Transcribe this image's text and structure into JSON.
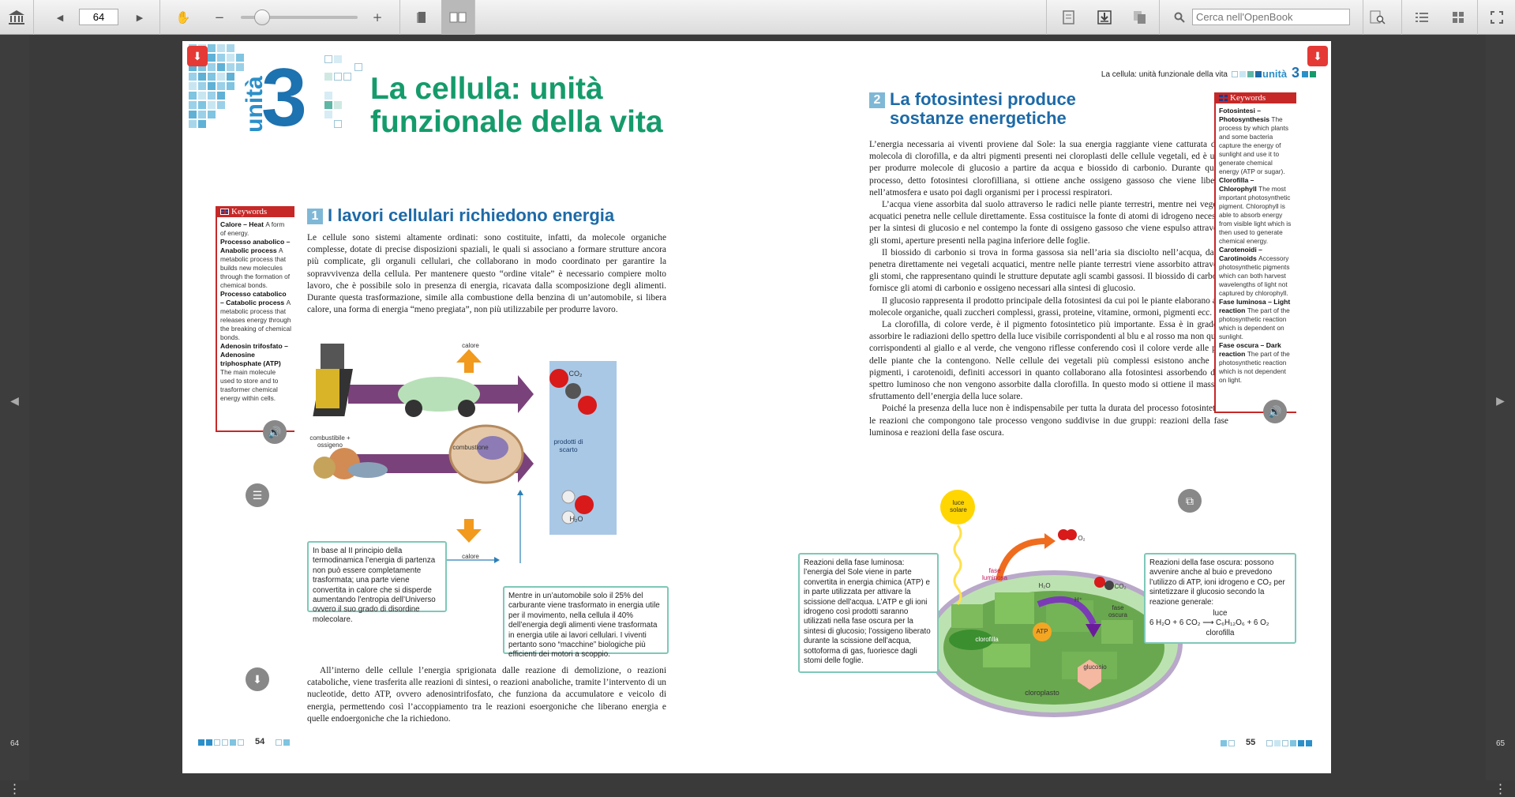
{
  "toolbar": {
    "page_number": "64",
    "search_placeholder": "Cerca nell'OpenBook"
  },
  "rails": {
    "left_page": "64",
    "right_page": "65",
    "left_arrow": "◀",
    "right_arrow": "▶",
    "menu": "⋮"
  },
  "left": {
    "unit_word": "unità",
    "unit_num": "3",
    "title_line1": "La cellula: unità",
    "title_line2": "funzionale della vita",
    "section_num": "1",
    "section_title": "I lavori cellulari richiedono energia",
    "para1": "Le cellule sono sistemi altamente ordinati: sono costituite, infatti, da molecole organiche complesse, dotate di precise disposizioni spaziali, le quali si associano a formare strutture ancora più complicate, gli organuli cellulari, che collaborano in modo coordinato per garantire la sopravvivenza della cellula. Per mantenere questo “ordine vitale” è necessario compiere molto lavoro, che è possibile solo in presenza di energia, ricavata dalla scomposizione degli alimenti. Durante questa trasformazione, simile alla combustione della benzina di un’automobile, si libera calore, una forma di energia “meno pregiata”, non più utilizzabile per produrre lavoro.",
    "para2": "All’interno delle cellule l’energia sprigionata dalle reazione di demolizione, o reazioni cataboliche, viene trasferita alle reazioni di sintesi, o reazioni anaboliche, tramite l’intervento di un nucleotide, detto ATP, ovvero adenosintrifosfato, che funziona da accumulatore e veicolo di energia, permettendo così l’accoppiamento tra le reazioni esoergoniche che liberano energia e quelle endoergoniche che la richiedono.",
    "kw_head": "Keywords",
    "kw_items": [
      {
        "term": "Calore – Heat",
        "def": "A form of energy."
      },
      {
        "term": "Processo anabolico – Anabolic process",
        "def": "A metabolic process that builds new molecules through the formation of chemical bonds."
      },
      {
        "term": "Processo catabolico – Catabolic process",
        "def": "A metabolic process that releases energy through the breaking of chemical bonds."
      },
      {
        "term": "Adenosin trifosfato – Adenosine triphosphate (ATP)",
        "def": "The main molecule used to store and to trasformer chemical energy within cells."
      }
    ],
    "fig": {
      "calore_top": "calore",
      "calore_bottom": "calore",
      "co2": "CO₂",
      "prodotti": "prodotti di scarto",
      "h2o": "H₂O",
      "combustibile": "combustibile + ossigeno",
      "combustione": "combustione",
      "h": "H",
      "o": "O",
      "c": "C"
    },
    "box1": "In base al II principio della termodinamica l’energia di partenza non può essere completamente trasformata; una parte viene convertita in calore che si disperde aumentando l’entropia dell’Universo ovvero il suo grado di disordine molecolare.",
    "box2": "Mentre in un’automobile solo il 25% del carburante viene trasformato in energia utile per il movimento, nella cellula il 40% dell’energia degli alimenti viene trasformata in energia utile ai lavori cellulari. I viventi pertanto sono “macchine” biologiche più efficienti dei motori a scoppio.",
    "page_num": "54"
  },
  "right": {
    "running_head": "La cellula: unità funzionale della vita",
    "unit_word": "unità",
    "unit_num": "3",
    "section_num": "2",
    "section_title1": "La fotosintesi produce",
    "section_title2": "sostanze energetiche",
    "paras": [
      "L’energia necessaria ai viventi proviene dal Sole: la sua energia raggiante viene catturata dalla molecola di clorofilla, e da altri pigmenti presenti nei cloroplasti delle cellule vegetali, ed è usata per produrre molecole di glucosio a partire da acqua e biossido di carbonio. Durante questo processo, detto fotosintesi clorofilliana, si ottiene anche ossigeno gassoso che viene liberato nell’atmosfera e usato poi dagli organismi per i processi respiratori.",
      "L’acqua viene assorbita dal suolo attraverso le radici nelle piante terrestri, mentre nei vegetali acquatici penetra nelle cellule direttamente. Essa costituisce la fonte di atomi di idrogeno necessari per la sintesi di glucosio e nel contempo la fonte di ossigeno gassoso che viene espulso attraverso gli stomi, aperture presenti nella pagina inferiore delle foglie.",
      "Il biossido di carbonio si trova in forma gassosa sia nell’aria sia disciolto nell’acqua, da cui penetra direttamente nei vegetali acquatici, mentre nelle piante terrestri viene assorbito attraverso gli stomi, che rappresentano quindi le strutture deputate agli scambi gassosi. Il biossido di carbonio fornisce gli atomi di carbonio e ossigeno necessari alla sintesi di glucosio.",
      "Il glucosio rappresenta il prodotto principale della fotosintesi da cui poi le piante elaborano altre molecole organiche, quali zuccheri complessi, grassi, proteine, vitamine, ormoni, pigmenti ecc.",
      "La clorofilla, di colore verde, è il pigmento fotosintetico più importante. Essa è in grado di assorbire le radiazioni dello spettro della luce visibile corrispondenti al blu e al rosso ma non quelle corrispondenti al giallo e al verde, che vengono riflesse conferendo così il colore verde alle parti delle piante che la contengono. Nelle cellule dei vegetali più complessi esistono anche altri pigmenti, i carotenoidi, definiti accessori in quanto collaborano alla fotosintesi assorbendo dello spettro luminoso che non vengono assorbite dalla clorofilla. In questo modo si ottiene il massimo sfruttamento dell’energia della luce solare.",
      "Poiché la presenza della luce non è indispensabile per tutta la durata del processo fotosintetico, le reazioni che compongono tale processo vengono suddivise in due gruppi: reazioni della fase luminosa e reazioni della fase oscura."
    ],
    "kw_head": "Keywords",
    "kw_items": [
      {
        "term": "Fotosintesi – Photosynthesis",
        "def": "The process by which plants and some bacteria capture the energy of sunlight and use it to generate chemical energy (ATP or sugar)."
      },
      {
        "term": "Clorofilla – Chlorophyll",
        "def": "The most important photosynthetic pigment. Chlorophyll is able to absorb energy from visible light which is then used to generate chemical energy."
      },
      {
        "term": "Carotenoidi – Carotinoids",
        "def": "Accessory photosynthetic pigments which can both harvest wavelengths of light not captured by chlorophyll."
      },
      {
        "term": "Fase luminosa – Light reaction",
        "def": "The part of the photosynthetic reaction which is dependent on sunlight."
      },
      {
        "term": "Fase oscura – Dark reaction",
        "def": "The part of the photosynthetic reaction which is not dependent on light."
      }
    ],
    "box_luminosa": "Reazioni della fase luminosa: l’energia del Sole viene in parte convertita in energia chimica (ATP) e in parte utilizzata per attivare la scissione dell’acqua. L’ATP e gli ioni idrogeno così prodotti saranno utilizzati nella fase oscura per la sintesi di glucosio; l’ossigeno liberato durante la scissione dell’acqua, sottoforma di gas, fuoriesce dagli stomi delle foglie.",
    "box_oscura": "Reazioni della fase oscura: possono avvenire anche al buio e prevedono l’utilizzo di ATP, ioni idrogeno e CO₂ per sintetizzare il glucosio secondo la reazione generale:",
    "eq_top": "luce",
    "eq": "6 H₂O + 6 CO₂ ⟶ C₆H₁₂O₆ + 6 O₂",
    "eq_bottom": "clorofilla",
    "fig": {
      "luce": "luce solare",
      "fase_luminosa": "fase luminosa",
      "fase_oscura": "fase oscura",
      "h2o": "H₂O",
      "o2": "O₂",
      "co2": "CO₂",
      "hplus": "H⁺",
      "clorofilla": "clorofilla",
      "atp": "ATP",
      "glucosio": "glucosio",
      "cloroplasto": "cloroplasto"
    },
    "page_num": "55"
  }
}
